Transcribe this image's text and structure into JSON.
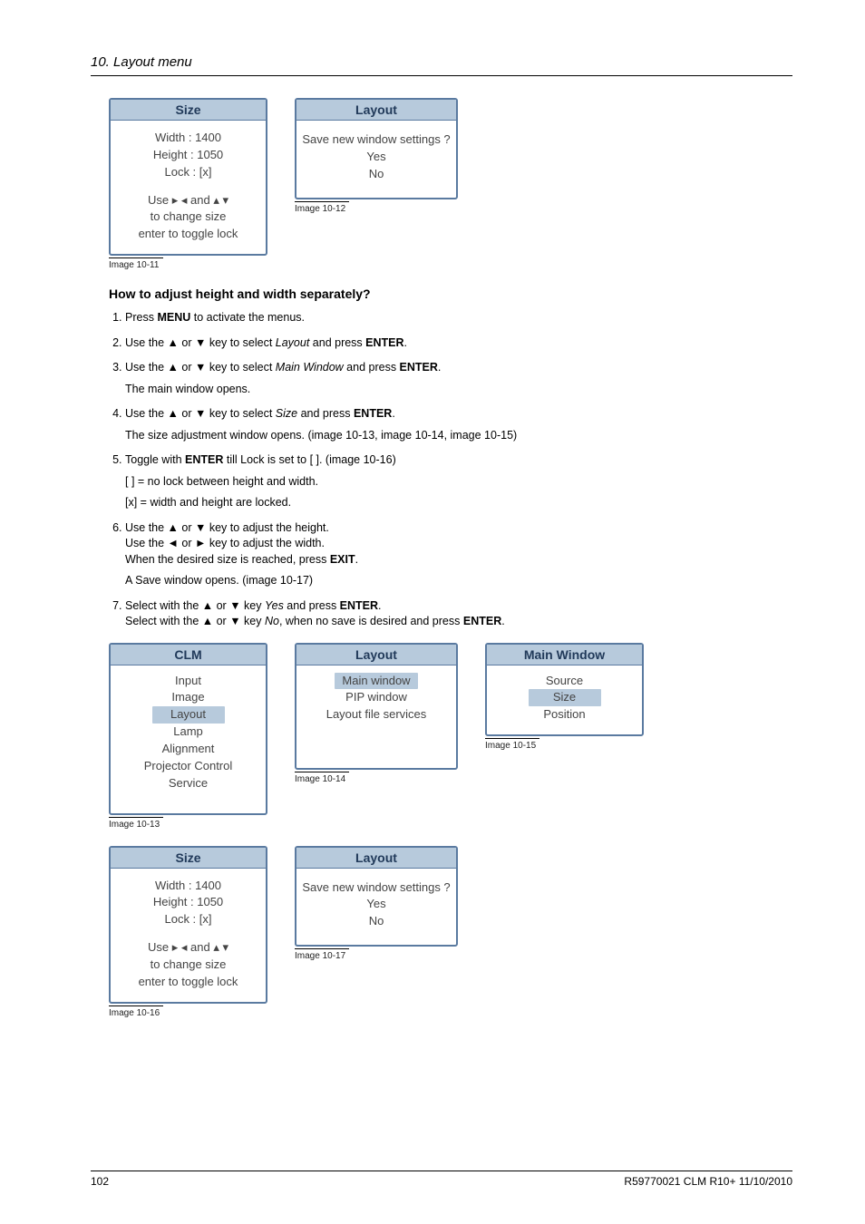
{
  "header": {
    "chapter": "10.  Layout menu"
  },
  "win_size": {
    "title": "Size",
    "width": "Width : 1400",
    "height": "Height : 1050",
    "lock": "Lock : [x]",
    "hint1": "Use ▸ ◂ and ▴ ▾",
    "hint2": "to change size",
    "hint3": "enter to toggle lock"
  },
  "win_save": {
    "title": "Layout",
    "prompt": "Save new window settings ?",
    "yes": "Yes",
    "no": "No"
  },
  "captions": {
    "c11": "Image 10-11",
    "c12": "Image 10-12",
    "c13": "Image 10-13",
    "c14": "Image 10-14",
    "c15": "Image 10-15",
    "c16": "Image 10-16",
    "c17": "Image 10-17"
  },
  "subhead": "How to adjust height and width separately?",
  "steps": {
    "s1_a": "Press ",
    "s1_b": "MENU",
    "s1_c": " to activate the menus.",
    "s2_a": "Use the ▲ or ▼ key to select ",
    "s2_b": "Layout",
    "s2_c": " and press ",
    "s2_d": "ENTER",
    "s2_e": ".",
    "s3_a": "Use the ▲ or ▼ key to select ",
    "s3_b": "Main Window",
    "s3_c": " and press ",
    "s3_d": "ENTER",
    "s3_e": ".",
    "s3_sub": "The main window opens.",
    "s4_a": "Use the ▲ or ▼ key to select ",
    "s4_b": "Size",
    "s4_c": " and press ",
    "s4_d": "ENTER",
    "s4_e": ".",
    "s4_sub": "The size adjustment window opens. (image 10-13, image 10-14, image 10-15)",
    "s5_a": "Toggle with ",
    "s5_b": "ENTER",
    "s5_c": " till Lock is set to [  ]. (image 10-16)",
    "s5_sub1": "[  ]  = no lock between height and width.",
    "s5_sub2": "[x] = width and height are locked.",
    "s6_l1": "Use the ▲ or ▼ key to adjust the height.",
    "s6_l2": "Use the ◄ or ► key to adjust the width.",
    "s6_l3a": "When the desired size is reached, press ",
    "s6_l3b": "EXIT",
    "s6_l3c": ".",
    "s6_sub": "A Save window opens. (image 10-17)",
    "s7_l1a": "Select with the ▲ or ▼ key ",
    "s7_l1b": "Yes",
    "s7_l1c": " and press ",
    "s7_l1d": "ENTER",
    "s7_l1e": ".",
    "s7_l2a": "Select with the ▲ or ▼ key ",
    "s7_l2b": "No",
    "s7_l2c": ", when no save is desired and press ",
    "s7_l2d": "ENTER",
    "s7_l2e": "."
  },
  "win_clm": {
    "title": "CLM",
    "items": {
      "i0": "Input",
      "i1": "Image",
      "i2": "Layout",
      "i3": "Lamp",
      "i4": "Alignment",
      "i5": "Projector Control",
      "i6": "Service"
    }
  },
  "win_layout_menu": {
    "title": "Layout",
    "items": {
      "i0": "Main window",
      "i1": "PIP window",
      "i2": "Layout file services"
    }
  },
  "win_main": {
    "title": "Main Window",
    "items": {
      "i0": "Source",
      "i1": "Size",
      "i2": "Position"
    }
  },
  "footer": {
    "left": "102",
    "right": "R59770021  CLM R10+  11/10/2010"
  }
}
